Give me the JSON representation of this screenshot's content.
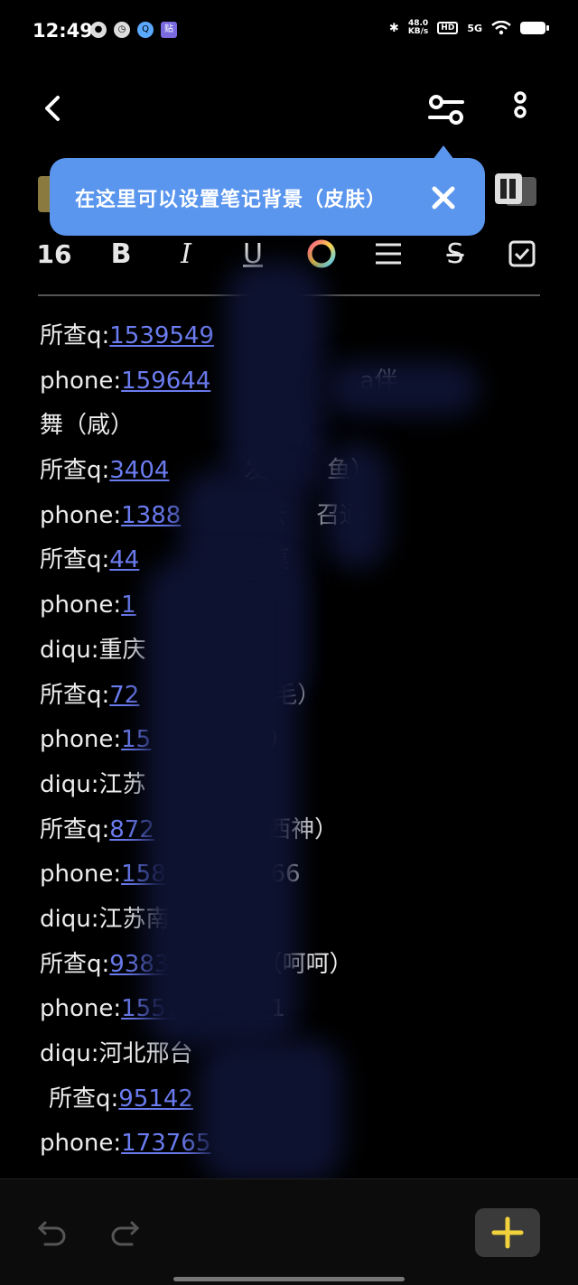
{
  "status": {
    "time": "12:49",
    "net_speed_top": "48.0",
    "net_speed_bottom": "KB/s",
    "hd": "HD",
    "net": "5G"
  },
  "toolbar": {
    "back": "back-icon",
    "settings": "settings-sliders-icon",
    "more": "more-vertical-icon"
  },
  "tooltip": {
    "text": "在这里可以设置笔记背景（皮肤）"
  },
  "format": {
    "font_size": "16",
    "bold": "B",
    "italic": "I",
    "underline": "U",
    "strike": "S"
  },
  "note_lines": [
    {
      "prefix": "所查q:",
      "link": "1539549",
      "suffix": ""
    },
    {
      "prefix": "phone:",
      "link": "159644",
      "suffix": "                    a伴"
    },
    {
      "prefix": "舞（咸）",
      "link": "",
      "suffix": ""
    },
    {
      "prefix": "所查q:",
      "link": "3404",
      "suffix": "          发        鱼）"
    },
    {
      "prefix": "phone:",
      "link": "1388",
      "suffix": "        7 云    召通"
    },
    {
      "prefix": "所查q:",
      "link": "44",
      "suffix": "                 莫"
    },
    {
      "prefix": "phone:",
      "link": "1",
      "suffix": ""
    },
    {
      "prefix": "diqu:重庆",
      "link": "",
      "suffix": ""
    },
    {
      "prefix": "所查q:",
      "link": "72",
      "suffix": "                  毛）"
    },
    {
      "prefix": "phone:",
      "link": "15",
      "suffix": "               0"
    },
    {
      "prefix": "diqu:江苏",
      "link": "",
      "suffix": ""
    },
    {
      "prefix": "所查q:",
      "link": "872",
      "suffix": "            （西神）"
    },
    {
      "prefix": "phone:",
      "link": "158",
      "suffix": "            666"
    },
    {
      "prefix": "diqu:江苏南",
      "link": "",
      "suffix": ""
    },
    {
      "prefix": "所查q:",
      "link": "9383",
      "suffix": "            （呵呵）"
    },
    {
      "prefix": "phone:",
      "link": "1551",
      "suffix": "          21"
    },
    {
      "prefix": "diqu:河北邢台",
      "link": "",
      "suffix": ""
    },
    {
      "prefix": "所查q:",
      "link": "95142",
      "suffix": "         （···）",
      "indent": true
    },
    {
      "prefix": "phone:",
      "link": "173765",
      "suffix": ""
    }
  ],
  "bottom": {
    "undo": "undo-icon",
    "redo": "redo-icon",
    "add": "+"
  },
  "colors": {
    "background": "#000000",
    "link": "#6b7cf0",
    "tooltip": "#5b96ee",
    "add_icon": "#f2d23c"
  }
}
